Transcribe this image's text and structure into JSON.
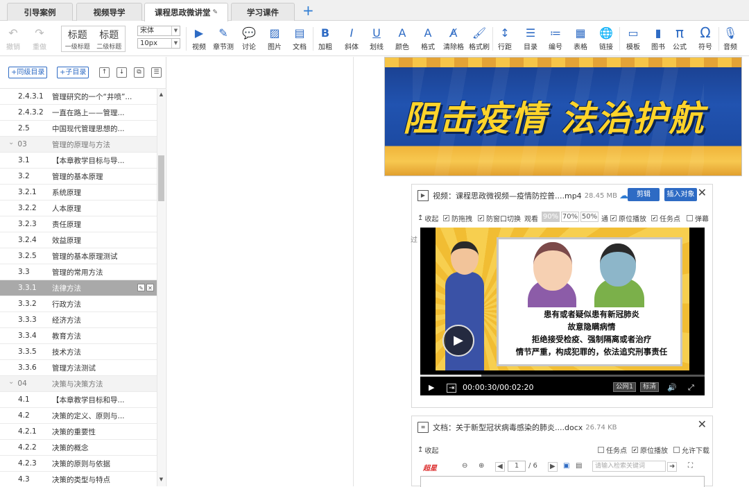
{
  "tabs": [
    {
      "label": "引导案例",
      "active": false
    },
    {
      "label": "视频导学",
      "active": false
    },
    {
      "label": "课程思政微讲堂",
      "active": true
    },
    {
      "label": "学习课件",
      "active": false
    }
  ],
  "toolbar": {
    "undo": "撤销",
    "redo": "重做",
    "heading1_big": "标题",
    "heading1_small": "一级标题",
    "heading2_big": "标题",
    "heading2_small": "二级标题",
    "font_family": "宋体",
    "font_size": "10px",
    "buttons": [
      {
        "label": "视频",
        "icon": "video-icon"
      },
      {
        "label": "章节测",
        "icon": "quiz-icon"
      },
      {
        "label": "讨论",
        "icon": "discussion-icon"
      },
      {
        "label": "图片",
        "icon": "image-icon"
      },
      {
        "label": "文档",
        "icon": "document-icon"
      },
      {
        "label": "加粗",
        "icon": "bold-icon"
      },
      {
        "label": "斜体",
        "icon": "italic-icon"
      },
      {
        "label": "划线",
        "icon": "underline-icon"
      },
      {
        "label": "颜色",
        "icon": "font-color-icon"
      },
      {
        "label": "格式",
        "icon": "font-format-icon"
      },
      {
        "label": "清除格",
        "icon": "clear-format-icon"
      },
      {
        "label": "格式刷",
        "icon": "format-painter-icon"
      },
      {
        "label": "行距",
        "icon": "line-height-icon"
      },
      {
        "label": "目录",
        "icon": "toc-icon"
      },
      {
        "label": "编号",
        "icon": "numbered-list-icon"
      },
      {
        "label": "表格",
        "icon": "table-icon"
      },
      {
        "label": "链接",
        "icon": "link-icon"
      },
      {
        "label": "模板",
        "icon": "template-icon"
      },
      {
        "label": "图书",
        "icon": "book-icon"
      },
      {
        "label": "公式",
        "icon": "formula-icon"
      },
      {
        "label": "符号",
        "icon": "symbol-icon"
      },
      {
        "label": "音频",
        "icon": "audio-icon"
      }
    ]
  },
  "outline": {
    "add_sibling": "+同级目录",
    "add_child": "+子目录",
    "items": [
      {
        "num": "2.4.3.1",
        "title": "管理研究的一个“井喷”...",
        "type": "item"
      },
      {
        "num": "2.4.3.2",
        "title": "一直在路上——管理...",
        "type": "item"
      },
      {
        "num": "2.5",
        "title": "中国现代管理思想的...",
        "type": "item"
      },
      {
        "num": "03",
        "title": "管理的原理与方法",
        "type": "chapter"
      },
      {
        "num": "3.1",
        "title": "【本章教学目标与导...",
        "type": "item"
      },
      {
        "num": "3.2",
        "title": "管理的基本原理",
        "type": "item"
      },
      {
        "num": "3.2.1",
        "title": "系统原理",
        "type": "item"
      },
      {
        "num": "3.2.2",
        "title": "人本原理",
        "type": "item"
      },
      {
        "num": "3.2.3",
        "title": "责任原理",
        "type": "item"
      },
      {
        "num": "3.2.4",
        "title": "效益原理",
        "type": "item"
      },
      {
        "num": "3.2.5",
        "title": "管理的基本原理测试",
        "type": "item"
      },
      {
        "num": "3.3",
        "title": "管理的常用方法",
        "type": "item"
      },
      {
        "num": "3.3.1",
        "title": "法律方法",
        "type": "selected"
      },
      {
        "num": "3.3.2",
        "title": "行政方法",
        "type": "item"
      },
      {
        "num": "3.3.3",
        "title": "经济方法",
        "type": "item"
      },
      {
        "num": "3.3.4",
        "title": "教育方法",
        "type": "item"
      },
      {
        "num": "3.3.5",
        "title": "技术方法",
        "type": "item"
      },
      {
        "num": "3.3.6",
        "title": "管理方法测试",
        "type": "item"
      },
      {
        "num": "04",
        "title": "决策与决策方法",
        "type": "chapter"
      },
      {
        "num": "4.1",
        "title": "【本章教学目标和导...",
        "type": "item"
      },
      {
        "num": "4.2",
        "title": "决策的定义、原则与...",
        "type": "item"
      },
      {
        "num": "4.2.1",
        "title": "决策的重要性",
        "type": "item"
      },
      {
        "num": "4.2.2",
        "title": "决策的概念",
        "type": "item"
      },
      {
        "num": "4.2.3",
        "title": "决策的原则与依据",
        "type": "item"
      },
      {
        "num": "4.3",
        "title": "决策的类型与特点",
        "type": "item"
      }
    ]
  },
  "banner": {
    "text": "阻击疫情 法治护航"
  },
  "video_card": {
    "title": "视频：课程思政微视频—疫情防控普....mp4",
    "size": "28.45 MB",
    "edit_button": "剪辑",
    "insert_button": "插入对象",
    "collapse": "收起",
    "options": {
      "anti_drag": "防拖拽",
      "anti_switch": "防窗口切换",
      "watch_label": "观看",
      "pct_90": "90%",
      "pct_70": "70%",
      "pct_50": "50%",
      "pass_label": "通",
      "inplace_play": "原位播放",
      "task_point": "任务点",
      "bullet": "弹幕"
    },
    "pass_suffix": "过",
    "slide_lines": [
      "患有或者疑似患有新冠肺炎",
      "故意隐瞒病情",
      "拒绝接受检疫、强制隔离或者治疗",
      "情节严重，构成犯罪的，依法追究刑事责任"
    ],
    "player": {
      "time": "00:00:30/00:02:20",
      "progress": 0.214,
      "line_label": "公网1",
      "quality_label": "标清"
    }
  },
  "doc_card": {
    "title": "文档：关于新型冠状病毒感染的肺炎....docx",
    "size": "26.74 KB",
    "collapse": "收起",
    "options": {
      "task_point": "任务点",
      "inplace_play": "原位播放",
      "allow_download": "允许下载"
    },
    "viewer": {
      "brand": "超星",
      "page_current": "1",
      "page_total": "/ 6",
      "search_placeholder": "请输入检索关键词"
    }
  }
}
